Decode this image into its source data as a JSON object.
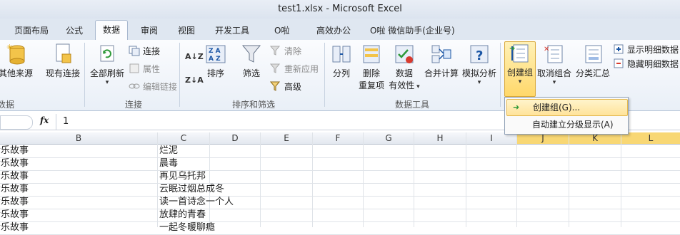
{
  "window": {
    "title": "test1.xlsx  -  Microsoft Excel"
  },
  "tabs": [
    "页面布局",
    "公式",
    "数据",
    "审阅",
    "视图",
    "开发工具",
    "O啦",
    "高效办公",
    "O啦 微信助手(企业号)"
  ],
  "active_tab": "数据",
  "ribbon": {
    "get_external": {
      "other_sources": "其他来源",
      "existing": "现有连接",
      "group_label": "数据"
    },
    "connections": {
      "refresh_all": "全部刷新",
      "connections": "连接",
      "properties": "属性",
      "edit_links": "编辑链接",
      "group_label": "连接"
    },
    "sort_filter": {
      "sort": "排序",
      "filter": "筛选",
      "clear": "清除",
      "reapply": "重新应用",
      "advanced": "高级",
      "group_label": "排序和筛选"
    },
    "data_tools": {
      "text_to_columns": "分列",
      "remove_dup_1": "删除",
      "remove_dup_2": "重复项",
      "validation_1": "数据",
      "validation_2": "有效性",
      "consolidate": "合并计算",
      "what_if": "模拟分析",
      "group_label": "数据工具"
    },
    "outline": {
      "group": "创建组",
      "ungroup": "取消组合",
      "subtotal": "分类汇总",
      "show_detail": "显示明细数据",
      "hide_detail": "隐藏明细数据"
    }
  },
  "dropdown": {
    "create_group": "创建组(G)...",
    "auto_outline": "自动建立分级显示(A)"
  },
  "formula_bar": {
    "fx": "fx",
    "value": "1"
  },
  "columns": [
    "B",
    "C",
    "D",
    "E",
    "F",
    "G",
    "H",
    "I",
    "J",
    "K",
    "L"
  ],
  "rows": [
    {
      "b": "音乐故事",
      "c": "烂泥"
    },
    {
      "b": "音乐故事",
      "c": "晨毒"
    },
    {
      "b": "音乐故事",
      "c": "再见乌托邦"
    },
    {
      "b": "音乐故事",
      "c": "云眠过烟总成冬"
    },
    {
      "b": "音乐故事",
      "c": "读一首诗念一个人"
    },
    {
      "b": "音乐故事",
      "c": "放肆的青春"
    },
    {
      "b": "音乐故事",
      "c": "一起冬暖聊瘾"
    }
  ]
}
